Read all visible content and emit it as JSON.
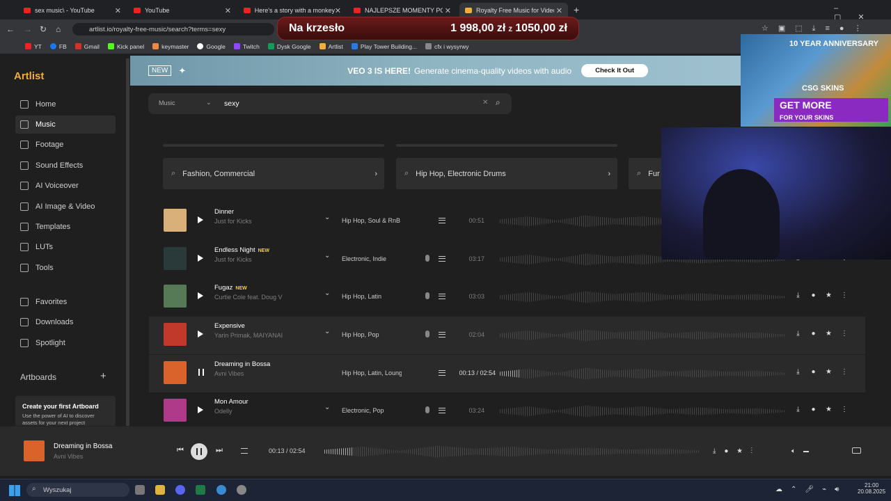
{
  "browser": {
    "tabs": [
      {
        "title": "sex music\\ - YouTube",
        "active": false
      },
      {
        "title": "YouTube",
        "active": false
      },
      {
        "title": "Here's a story with a monkey u",
        "active": false
      },
      {
        "title": "NAJLEPSZE MOMENTY POLSKIE",
        "active": false
      },
      {
        "title": "Royalty Free Music for Video C",
        "active": true
      }
    ],
    "url": "artlist.io/royalty-free-music/search?terms=sexy",
    "bookmarks": [
      "YT",
      "FB",
      "Gmail",
      "Kick panel",
      "keymaster",
      "Google",
      "Twitch",
      "Dysk Google",
      "Artlist",
      "Play Tower Building...",
      "cfx i wysyrwy"
    ]
  },
  "overlay_price": {
    "label": "Na krzesło",
    "old_price": "1 998,00 zł",
    "z": "z",
    "new_price": "1050,00 zł"
  },
  "sidebar": {
    "logo": "Artlist",
    "items": [
      {
        "label": "Home"
      },
      {
        "label": "Music",
        "selected": true
      },
      {
        "label": "Footage"
      },
      {
        "label": "Sound Effects"
      },
      {
        "label": "AI Voiceover"
      },
      {
        "label": "AI Image & Video"
      },
      {
        "label": "Templates"
      },
      {
        "label": "LUTs"
      },
      {
        "label": "Tools"
      }
    ],
    "secondary": [
      {
        "label": "Favorites"
      },
      {
        "label": "Downloads"
      },
      {
        "label": "Spotlight"
      }
    ],
    "artboards_label": "Artboards",
    "artboard_card": {
      "title": "Create your first Artboard",
      "text": "Use the power of AI to discover assets for your next project"
    }
  },
  "banner": {
    "badge": "NEW",
    "headline": "VEO 3 IS HERE!",
    "text": "Generate cinema-quality videos with audio",
    "cta": "Check It Out"
  },
  "search": {
    "type_select": "Music",
    "query": "sexy"
  },
  "categories": [
    "Fashion, Commercial",
    "Hip Hop, Electronic Drums",
    "Fur"
  ],
  "tracks": [
    {
      "title": "Dinner",
      "artist": "Just for Kicks",
      "genre": "Hip Hop, Soul & RnB",
      "duration": "00:51",
      "new": false,
      "vocal": false,
      "color": "#d9b07a"
    },
    {
      "title": "Endless Night",
      "artist": "Just for Kicks",
      "genre": "Electronic, Indie",
      "duration": "03:17",
      "new": true,
      "vocal": true,
      "color": "#2a3a3a"
    },
    {
      "title": "Fugaz",
      "artist": "Curtie Cole feat. Doug V",
      "genre": "Hip Hop, Latin",
      "duration": "03:03",
      "new": true,
      "vocal": true,
      "color": "#557a55"
    },
    {
      "title": "Expensive",
      "artist": "Yarin Primak, MAIYANAI",
      "genre": "Hip Hop, Pop",
      "duration": "02:04",
      "new": false,
      "vocal": true,
      "color": "#c0392b"
    },
    {
      "title": "Dreaming in Bossa",
      "artist": "Avni Vibes",
      "genre": "Hip Hop, Latin, Lounge",
      "duration": "00:13 / 02:54",
      "new": false,
      "vocal": false,
      "playing": true,
      "progress": 0.074,
      "color": "#d9632b"
    },
    {
      "title": "Mon Amour",
      "artist": "Odelly",
      "genre": "Electronic, Pop",
      "duration": "03:24",
      "new": false,
      "vocal": true,
      "color": "#b03a8a"
    }
  ],
  "badge_new": "NEW",
  "player": {
    "title": "Dreaming in Bossa",
    "artist": "Avni Vibes",
    "time": "00:13 / 02:54",
    "progress": 0.074
  },
  "ad": {
    "text1": "10 YEAR ANNIVERSARY",
    "text2": "CSG SKINS",
    "text3": "GET MORE",
    "text4": "FOR YOUR SKINS"
  },
  "taskbar": {
    "search_placeholder": "Wyszukaj",
    "time": "21:00",
    "date": "20.08.2025"
  }
}
